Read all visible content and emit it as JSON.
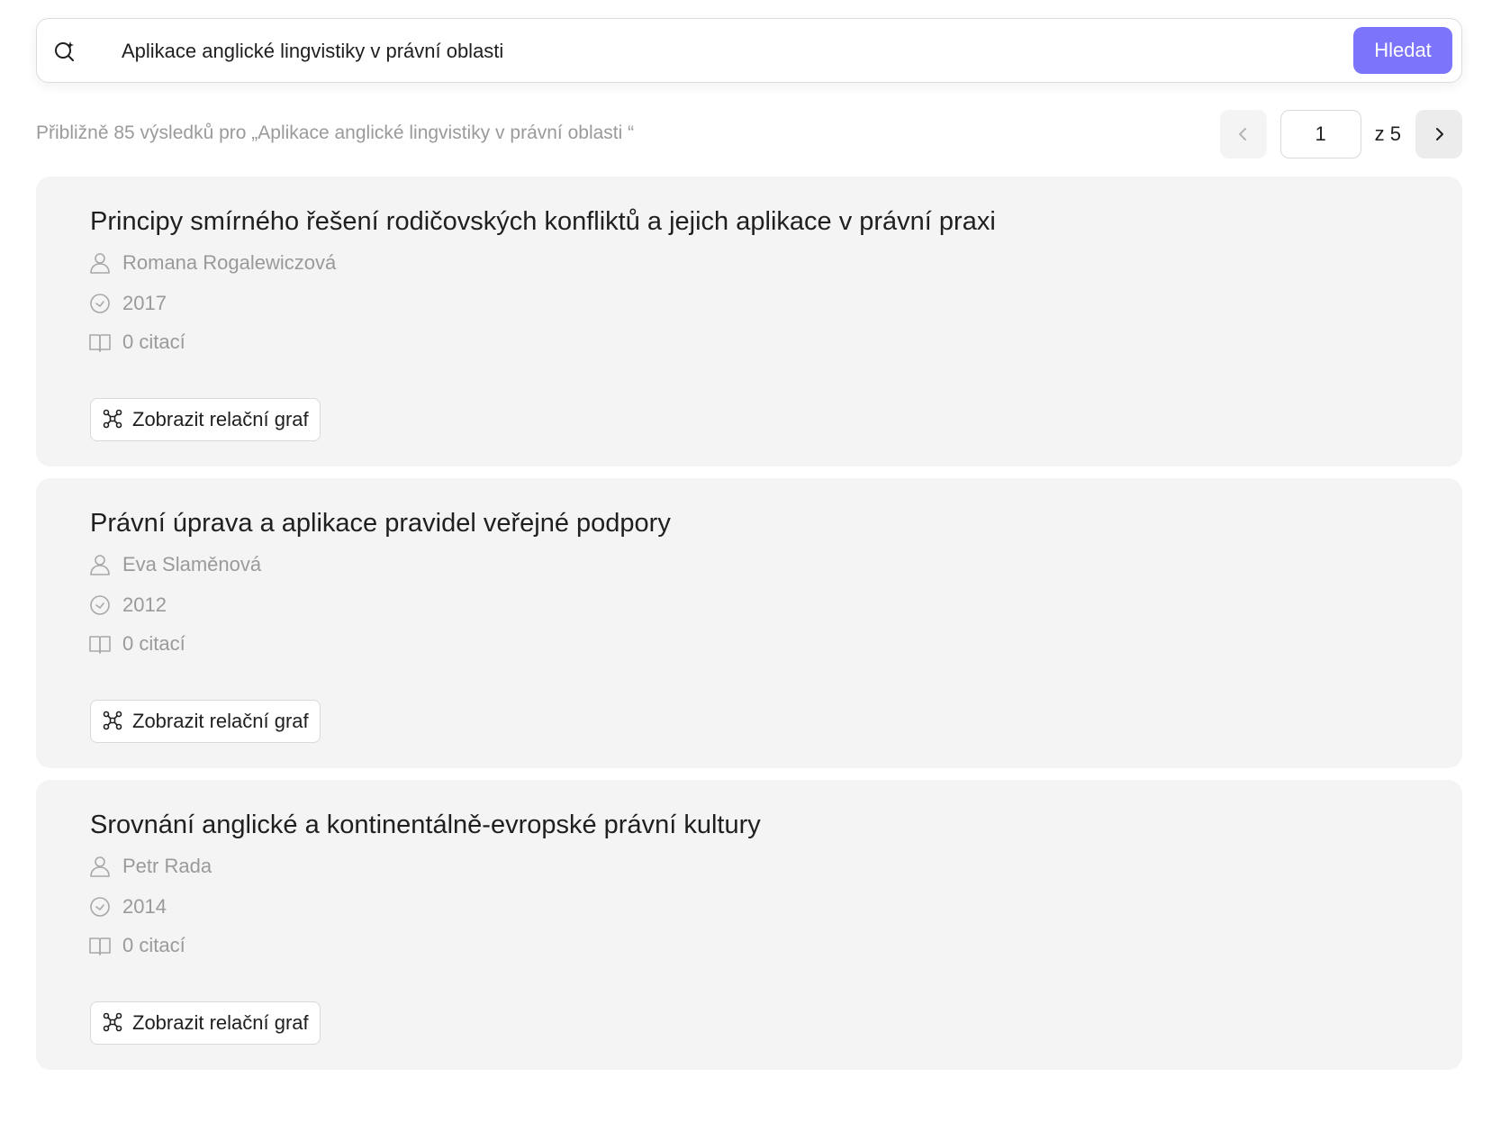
{
  "search": {
    "query": "Aplikace anglické lingvistiky v právní oblasti",
    "button_label": "Hledat",
    "icon": "search-sparkle-icon"
  },
  "summary": {
    "text": "Přibližně 85 výsledků pro „Aplikace anglické lingvistiky v právní oblasti  “"
  },
  "pagination": {
    "current_page": "1",
    "total_label": "z 5",
    "prev_icon": "chevron-left-icon",
    "next_icon": "chevron-right-icon"
  },
  "results": [
    {
      "title": "Principy smírného řešení rodičovských konfliktů a jejich aplikace v právní praxi",
      "author": "Romana Rogalewiczová",
      "year": "2017",
      "citations": "0 citací",
      "graph_button_label": "Zobrazit relační graf"
    },
    {
      "title": "Právní úprava a aplikace pravidel veřejné podpory",
      "author": "Eva Slaměnová",
      "year": "2012",
      "citations": "0 citací",
      "graph_button_label": "Zobrazit relační graf"
    },
    {
      "title": "Srovnání anglické a kontinentálně-evropské právní kultury",
      "author": "Petr Rada",
      "year": "2014",
      "citations": "0 citací",
      "graph_button_label": "Zobrazit relační graf"
    }
  ],
  "colors": {
    "accent": "#7c74fb",
    "card_background": "#f4f4f4",
    "muted_text": "#9a9a9a"
  }
}
